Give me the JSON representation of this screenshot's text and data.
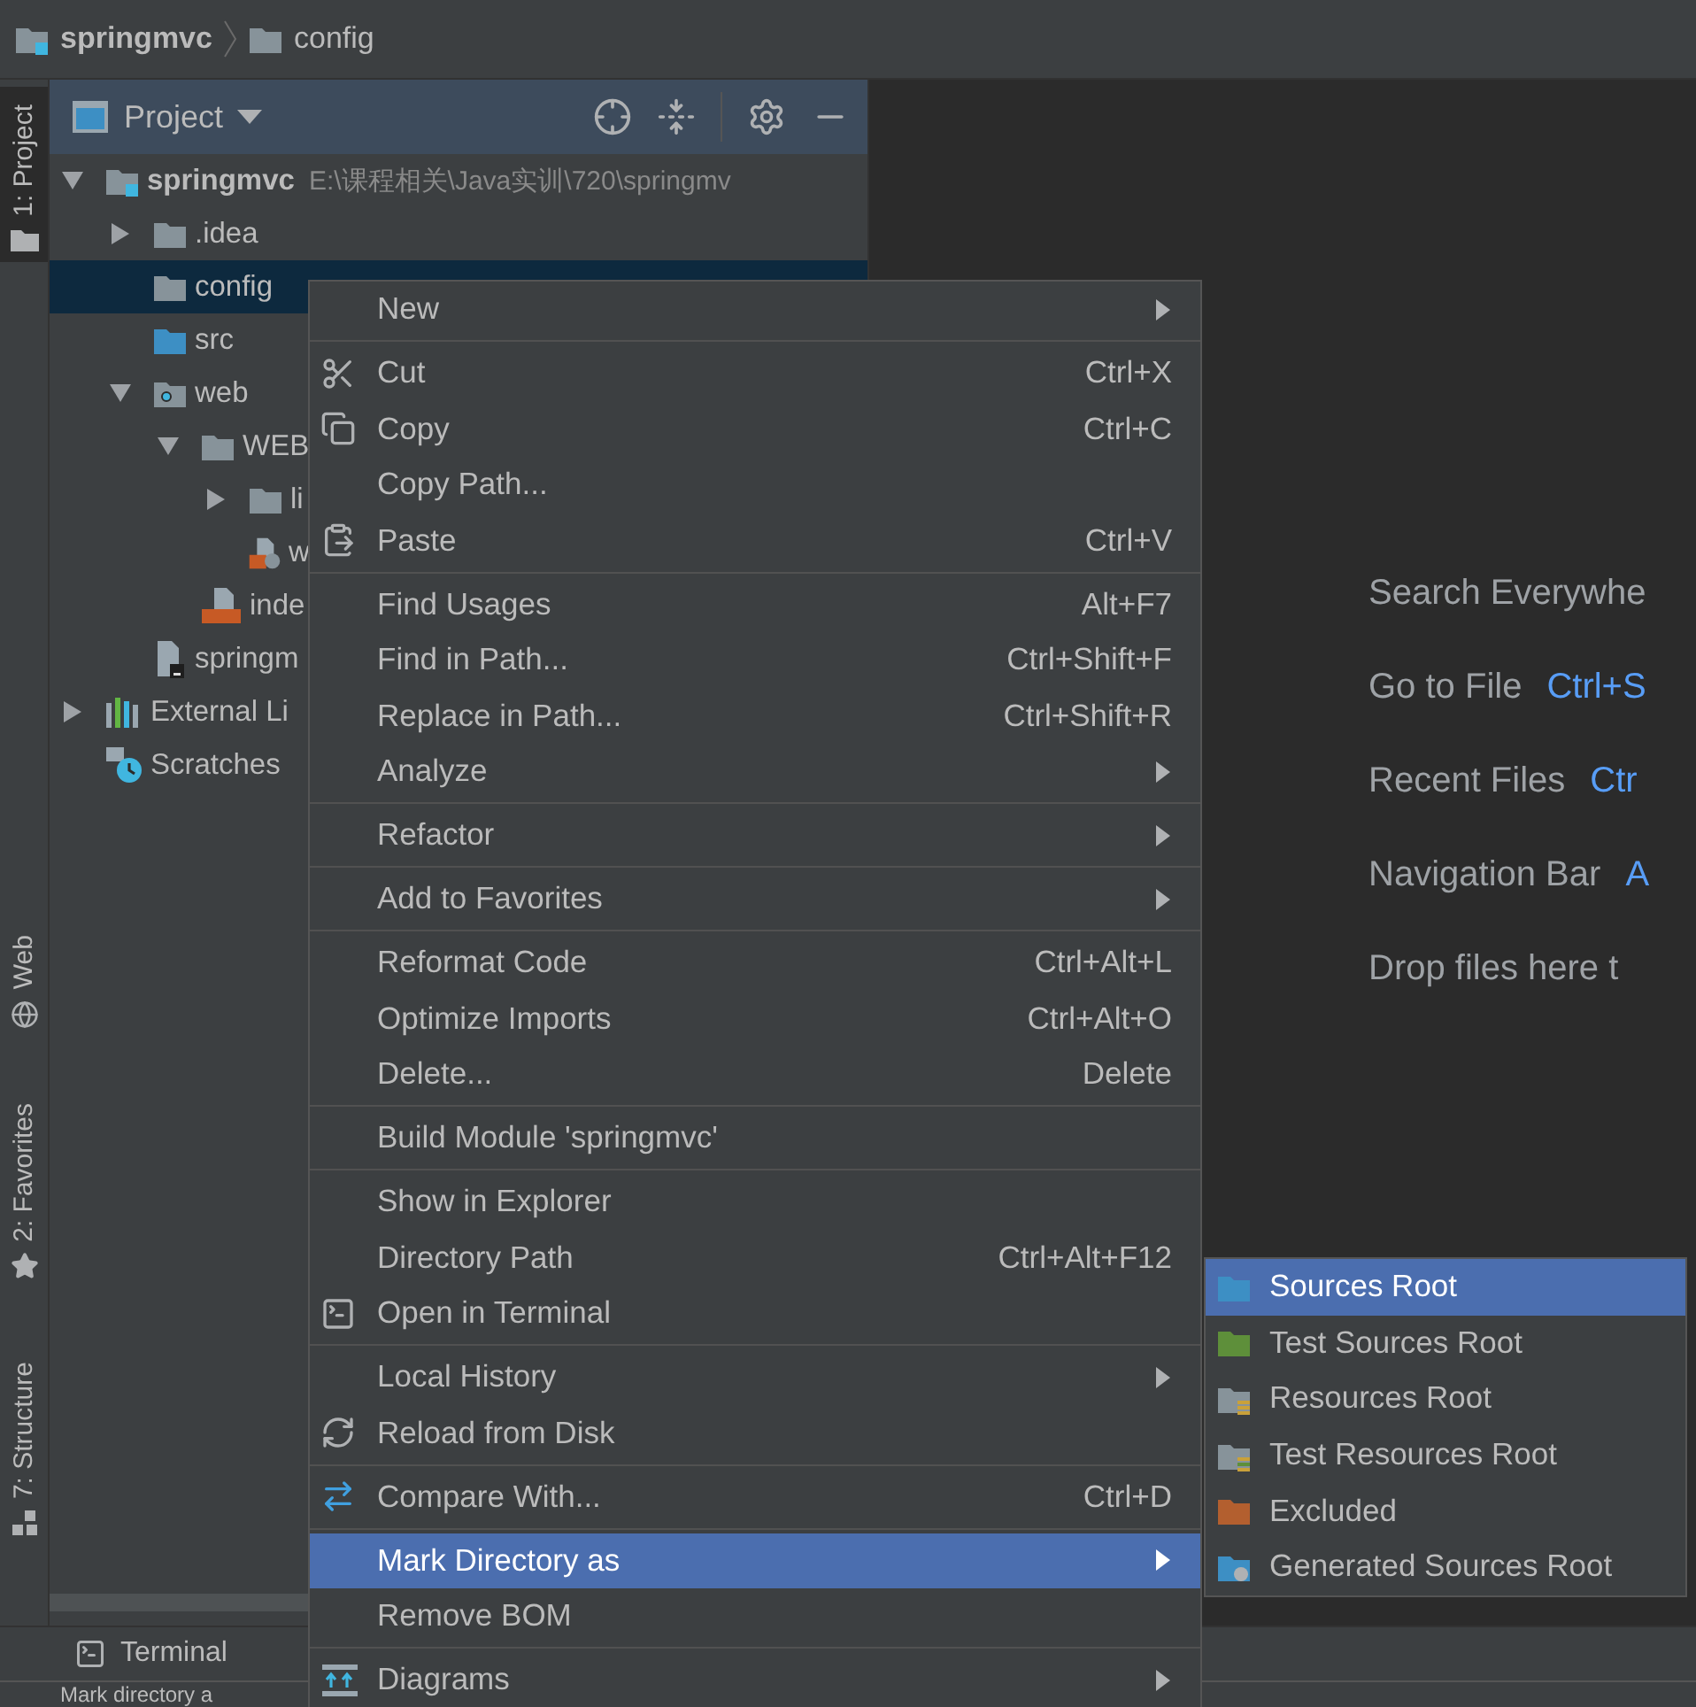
{
  "breadcrumbs": [
    {
      "label": "springmvc",
      "kind": "module"
    },
    {
      "label": "config",
      "kind": "folder"
    }
  ],
  "side_tabs": [
    {
      "label": "1: Project",
      "kind": "folder",
      "selected": true
    },
    {
      "label": "Web",
      "kind": "globe",
      "selected": false
    },
    {
      "label": "2: Favorites",
      "kind": "star",
      "selected": false
    },
    {
      "label": "7: Structure",
      "kind": "structure",
      "selected": false
    }
  ],
  "project_panel": {
    "title": "Project",
    "tree": [
      {
        "label": "springmvc",
        "path": "E:\\课程相关\\Java实训\\720\\springmv",
        "kind": "module",
        "expanded": true,
        "selected": false,
        "children": [
          {
            "label": ".idea",
            "kind": "folder",
            "expanded": false,
            "selected": false
          },
          {
            "label": "config",
            "kind": "folder",
            "selected": true
          },
          {
            "label": "src",
            "kind": "source",
            "selected": false
          },
          {
            "label": "web",
            "kind": "web",
            "expanded": true,
            "selected": false,
            "children": [
              {
                "label": "WEB",
                "kind": "folder",
                "expanded": true,
                "selected": false,
                "children": [
                  {
                    "label": "li",
                    "kind": "folder",
                    "expanded": false,
                    "selected": false
                  },
                  {
                    "label": "w",
                    "kind": "xml",
                    "selected": false
                  }
                ]
              },
              {
                "label": "inde",
                "kind": "jsp",
                "selected": false
              }
            ]
          },
          {
            "label": "springm",
            "kind": "iml",
            "selected": false
          }
        ]
      },
      {
        "label": "External Li",
        "kind": "libs",
        "expanded": false,
        "selected": false
      },
      {
        "label": "Scratches",
        "kind": "scratches",
        "selected": false
      }
    ]
  },
  "editor_hints": [
    {
      "label": "Search Everywhe"
    },
    {
      "label": "Go to File",
      "shortcut": "Ctrl+S"
    },
    {
      "label": "Recent Files",
      "shortcut": "Ctr"
    },
    {
      "label": "Navigation Bar",
      "shortcut": "A"
    },
    {
      "label": "Drop files here t"
    }
  ],
  "context_menu": [
    {
      "kind": "item",
      "label": "New",
      "submenu": true,
      "selected": false
    },
    {
      "kind": "separator"
    },
    {
      "kind": "item",
      "label": "Cut",
      "shortcut": "Ctrl+X",
      "selected": false
    },
    {
      "kind": "item",
      "label": "Copy",
      "shortcut": "Ctrl+C",
      "selected": false
    },
    {
      "kind": "item",
      "label": "Copy Path...",
      "selected": false
    },
    {
      "kind": "item",
      "label": "Paste",
      "shortcut": "Ctrl+V",
      "selected": false
    },
    {
      "kind": "separator"
    },
    {
      "kind": "item",
      "label": "Find Usages",
      "shortcut": "Alt+F7",
      "selected": false
    },
    {
      "kind": "item",
      "label": "Find in Path...",
      "shortcut": "Ctrl+Shift+F",
      "selected": false
    },
    {
      "kind": "item",
      "label": "Replace in Path...",
      "shortcut": "Ctrl+Shift+R",
      "selected": false
    },
    {
      "kind": "item",
      "label": "Analyze",
      "submenu": true,
      "selected": false
    },
    {
      "kind": "separator"
    },
    {
      "kind": "item",
      "label": "Refactor",
      "submenu": true,
      "selected": false
    },
    {
      "kind": "separator"
    },
    {
      "kind": "item",
      "label": "Add to Favorites",
      "submenu": true,
      "selected": false
    },
    {
      "kind": "separator"
    },
    {
      "kind": "item",
      "label": "Reformat Code",
      "shortcut": "Ctrl+Alt+L",
      "selected": false
    },
    {
      "kind": "item",
      "label": "Optimize Imports",
      "shortcut": "Ctrl+Alt+O",
      "selected": false
    },
    {
      "kind": "item",
      "label": "Delete...",
      "shortcut": "Delete",
      "selected": false
    },
    {
      "kind": "separator"
    },
    {
      "kind": "item",
      "label": "Build Module 'springmvc'",
      "selected": false
    },
    {
      "kind": "separator"
    },
    {
      "kind": "item",
      "label": "Show in Explorer",
      "selected": false
    },
    {
      "kind": "item",
      "label": "Directory Path",
      "shortcut": "Ctrl+Alt+F12",
      "selected": false
    },
    {
      "kind": "item",
      "label": "Open in Terminal",
      "selected": false
    },
    {
      "kind": "separator"
    },
    {
      "kind": "item",
      "label": "Local History",
      "submenu": true,
      "selected": false
    },
    {
      "kind": "item",
      "label": "Reload from Disk",
      "selected": false
    },
    {
      "kind": "separator"
    },
    {
      "kind": "item",
      "label": "Compare With...",
      "shortcut": "Ctrl+D",
      "selected": false
    },
    {
      "kind": "separator"
    },
    {
      "kind": "item",
      "label": "Mark Directory as",
      "submenu": true,
      "selected": true
    },
    {
      "kind": "item",
      "label": "Remove BOM",
      "selected": false
    },
    {
      "kind": "separator"
    },
    {
      "kind": "item",
      "label": "Diagrams",
      "submenu": true,
      "selected": false
    }
  ],
  "submenu": [
    {
      "label": "Sources Root",
      "kind": "folder",
      "color": "#3d8fc4",
      "selected": true
    },
    {
      "label": "Test Sources Root",
      "kind": "folder",
      "color": "#5e8f3a",
      "selected": false
    },
    {
      "label": "Resources Root",
      "kind": "resources",
      "color": "#87939a",
      "selected": false
    },
    {
      "label": "Test Resources Root",
      "kind": "test-resources",
      "color": "#87939a",
      "selected": false
    },
    {
      "label": "Excluded",
      "kind": "folder",
      "color": "#b35f2f",
      "selected": false
    },
    {
      "label": "Generated Sources Root",
      "kind": "generated",
      "color": "#3d8fc4",
      "selected": false
    }
  ],
  "tool_tabs": [
    {
      "label": "Terminal",
      "kind": "terminal"
    }
  ],
  "status": "Mark directory a"
}
